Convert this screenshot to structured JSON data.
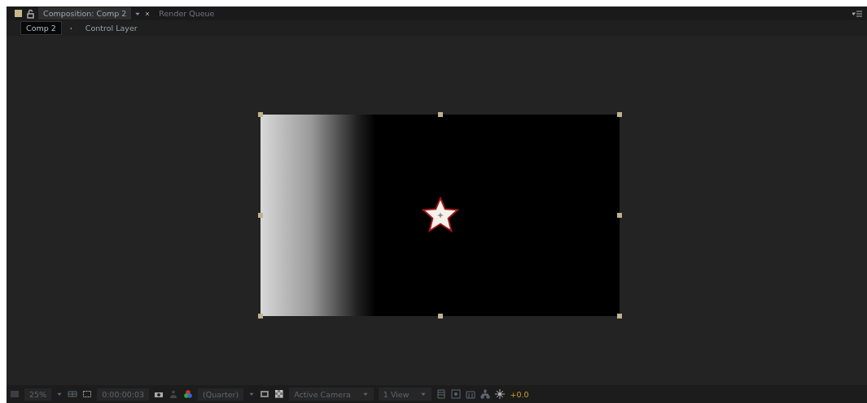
{
  "tabs": [
    {
      "label": "Composition: Comp 2",
      "selected": true
    },
    {
      "label": "Render Queue",
      "selected": false
    }
  ],
  "breadcrumb": [
    {
      "label": "Comp 2",
      "selected": true
    },
    {
      "label": "Control Layer",
      "selected": false
    }
  ],
  "toolbar": {
    "zoom": "25%",
    "timecode": "0:00:00:03",
    "resolution": "(Quarter)",
    "camera": "Active Camera",
    "views": "1 View",
    "exposure": "+0.0"
  }
}
